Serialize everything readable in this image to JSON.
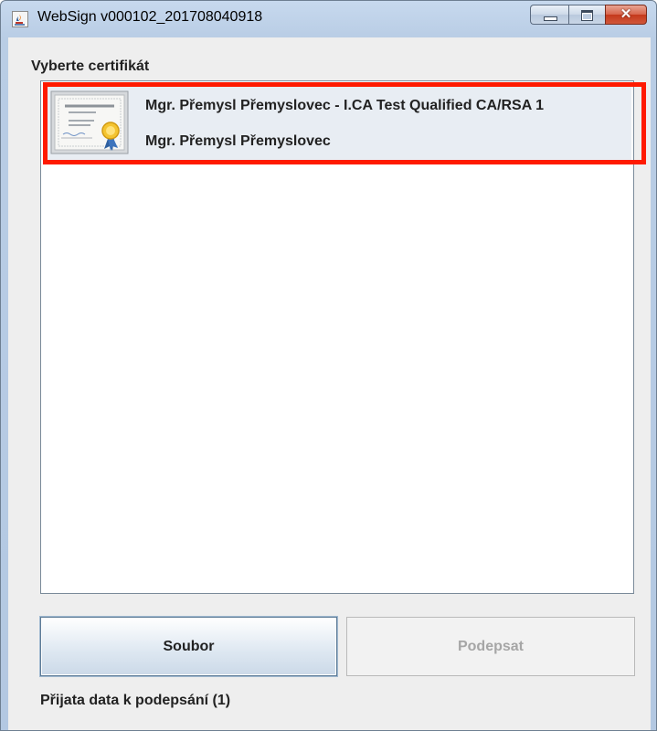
{
  "window": {
    "title": "WebSign v000102_201708040918",
    "close_glyph": "✕"
  },
  "icons": {
    "app": "java-cup-icon",
    "certificate": "certificate-icon",
    "minimize": "minimize-icon",
    "maximize": "maximize-icon",
    "close": "close-icon"
  },
  "main": {
    "section_label": "Vyberte certifikát",
    "certificates": [
      {
        "line1": "Mgr. Přemysl Přemyslovec - I.CA Test Qualified CA/RSA 1",
        "line2": "Mgr. Přemysl Přemyslovec",
        "selected": true
      }
    ]
  },
  "buttons": {
    "file_label": "Soubor",
    "sign_label": "Podepsat",
    "sign_enabled": false
  },
  "status": {
    "text": "Přijata data k podepsání (1)"
  },
  "colors": {
    "highlight": "#ff1a00",
    "selection": "#e8edf3"
  }
}
